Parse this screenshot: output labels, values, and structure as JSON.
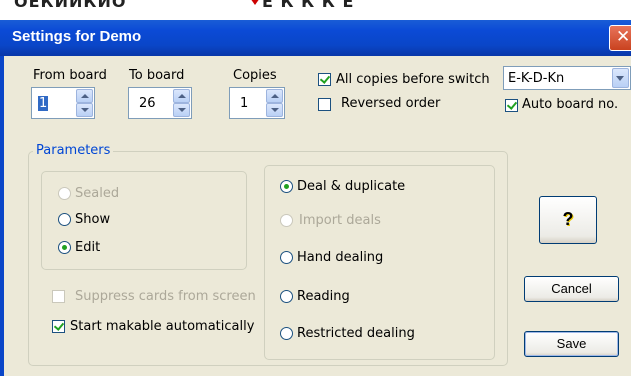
{
  "window": {
    "title": "Settings for Demo",
    "close_glyph": "✕"
  },
  "background_text": {
    "left": "ОЕКИИКИО",
    "right": "Е К К К Е"
  },
  "top": {
    "from_board": {
      "label": "From board",
      "value": "1"
    },
    "to_board": {
      "label": "To board",
      "value": "26"
    },
    "copies": {
      "label": "Copies",
      "value": "1"
    },
    "all_copies_before_switch": {
      "label": "All copies before switch",
      "checked": true
    },
    "reversed_order": {
      "label": "Reversed order",
      "checked": false
    },
    "seat_order": {
      "selected": "E-K-D-Kn"
    },
    "auto_board_no": {
      "label": "Auto board no.",
      "checked": true
    }
  },
  "parameters": {
    "label": "Parameters",
    "mode": [
      {
        "label": "Sealed",
        "selected": false,
        "enabled": false
      },
      {
        "label": "Show",
        "selected": false,
        "enabled": true
      },
      {
        "label": "Edit",
        "selected": true,
        "enabled": true
      }
    ],
    "suppress_cards": {
      "label": "Suppress cards from screen",
      "checked": false,
      "enabled": false
    },
    "start_makable": {
      "label": "Start makable automatically",
      "checked": true,
      "enabled": true
    },
    "deal_source": [
      {
        "label": "Deal & duplicate",
        "selected": true,
        "enabled": true
      },
      {
        "label": "Import deals",
        "selected": false,
        "enabled": false
      },
      {
        "label": "Hand dealing",
        "selected": false,
        "enabled": true
      },
      {
        "label": "Reading",
        "selected": false,
        "enabled": true
      },
      {
        "label": "Restricted dealing",
        "selected": false,
        "enabled": true
      }
    ]
  },
  "buttons": {
    "help": {
      "icon": "help-question-icon",
      "glyph": "?"
    },
    "cancel": "Cancel",
    "save": "Save"
  }
}
